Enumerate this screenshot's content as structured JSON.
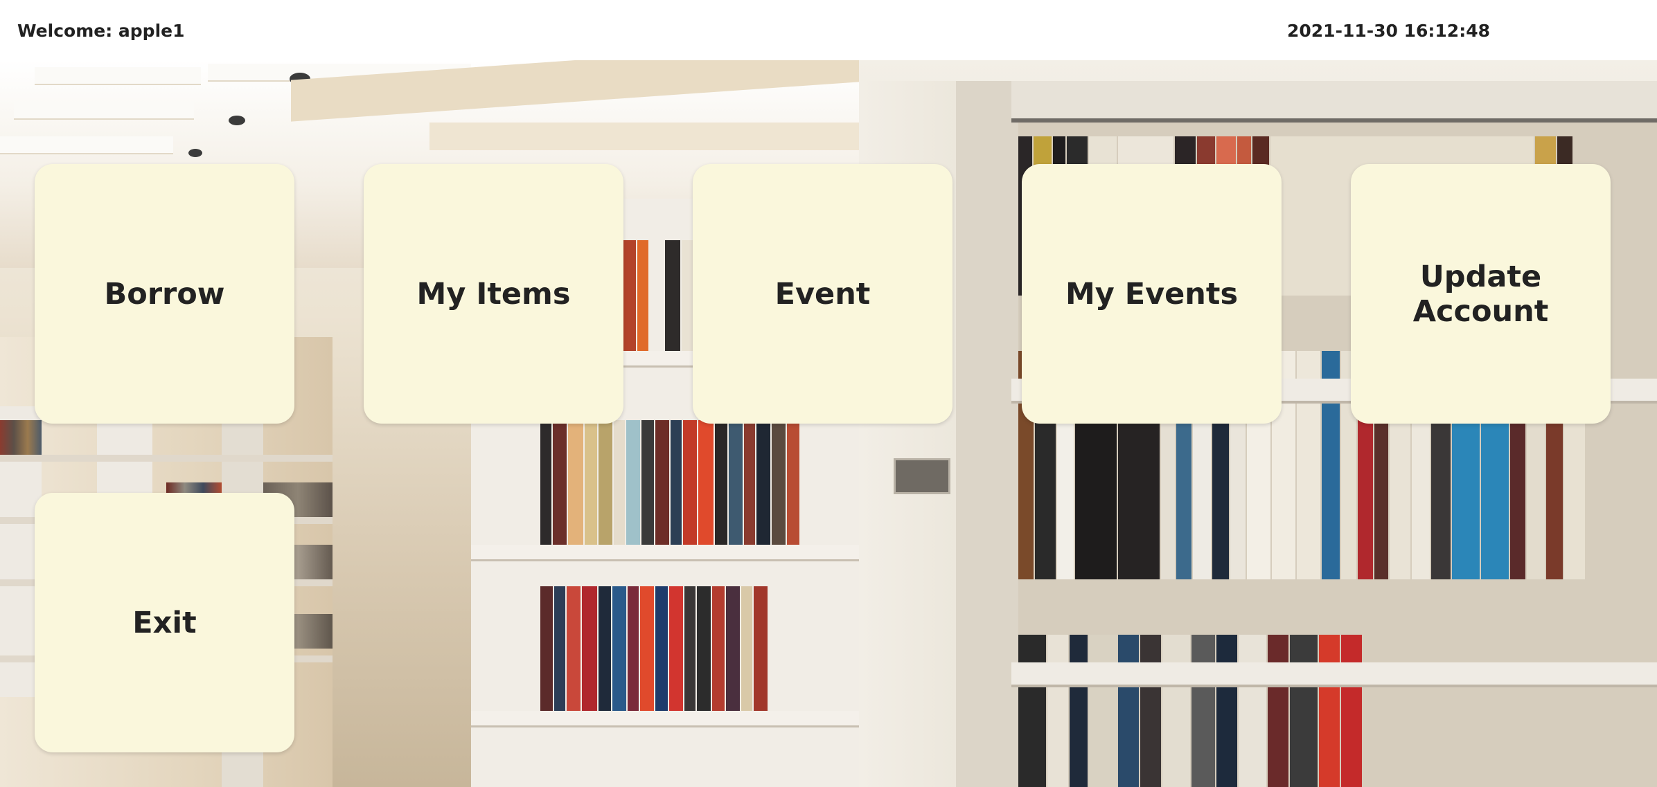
{
  "header": {
    "welcome_text": "Welcome: apple1",
    "datetime": "2021-11-30 16:12:48"
  },
  "menu": {
    "tiles": [
      {
        "label": "Borrow"
      },
      {
        "label": "My Items"
      },
      {
        "label": "Event"
      },
      {
        "label": "My Events"
      },
      {
        "label": "Update Account"
      },
      {
        "label": "Exit"
      }
    ]
  },
  "colors": {
    "tile_background": "#faf7dc",
    "tile_text": "#222222",
    "header_background": "#ffffff"
  }
}
